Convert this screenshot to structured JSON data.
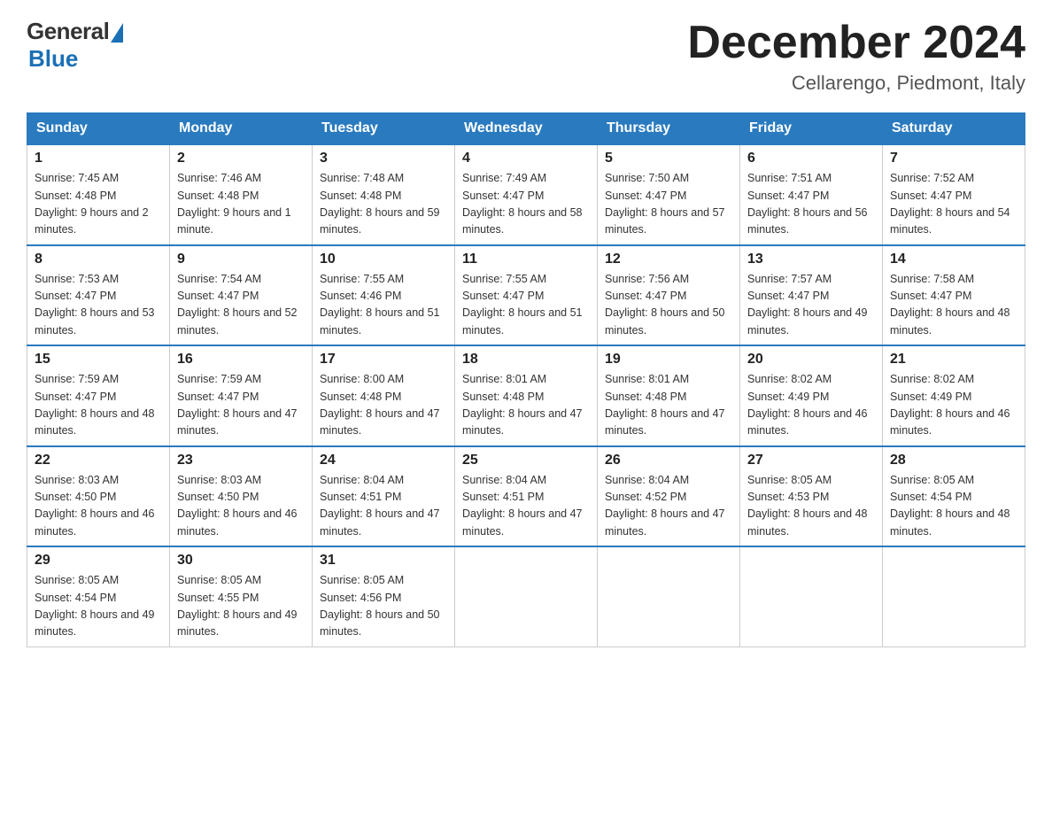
{
  "logo": {
    "general": "General",
    "blue": "Blue",
    "tagline": "Blue"
  },
  "title": "December 2024",
  "location": "Cellarengo, Piedmont, Italy",
  "days_of_week": [
    "Sunday",
    "Monday",
    "Tuesday",
    "Wednesday",
    "Thursday",
    "Friday",
    "Saturday"
  ],
  "weeks": [
    [
      {
        "day": "1",
        "sunrise": "7:45 AM",
        "sunset": "4:48 PM",
        "daylight": "9 hours and 2 minutes."
      },
      {
        "day": "2",
        "sunrise": "7:46 AM",
        "sunset": "4:48 PM",
        "daylight": "9 hours and 1 minute."
      },
      {
        "day": "3",
        "sunrise": "7:48 AM",
        "sunset": "4:48 PM",
        "daylight": "8 hours and 59 minutes."
      },
      {
        "day": "4",
        "sunrise": "7:49 AM",
        "sunset": "4:47 PM",
        "daylight": "8 hours and 58 minutes."
      },
      {
        "day": "5",
        "sunrise": "7:50 AM",
        "sunset": "4:47 PM",
        "daylight": "8 hours and 57 minutes."
      },
      {
        "day": "6",
        "sunrise": "7:51 AM",
        "sunset": "4:47 PM",
        "daylight": "8 hours and 56 minutes."
      },
      {
        "day": "7",
        "sunrise": "7:52 AM",
        "sunset": "4:47 PM",
        "daylight": "8 hours and 54 minutes."
      }
    ],
    [
      {
        "day": "8",
        "sunrise": "7:53 AM",
        "sunset": "4:47 PM",
        "daylight": "8 hours and 53 minutes."
      },
      {
        "day": "9",
        "sunrise": "7:54 AM",
        "sunset": "4:47 PM",
        "daylight": "8 hours and 52 minutes."
      },
      {
        "day": "10",
        "sunrise": "7:55 AM",
        "sunset": "4:46 PM",
        "daylight": "8 hours and 51 minutes."
      },
      {
        "day": "11",
        "sunrise": "7:55 AM",
        "sunset": "4:47 PM",
        "daylight": "8 hours and 51 minutes."
      },
      {
        "day": "12",
        "sunrise": "7:56 AM",
        "sunset": "4:47 PM",
        "daylight": "8 hours and 50 minutes."
      },
      {
        "day": "13",
        "sunrise": "7:57 AM",
        "sunset": "4:47 PM",
        "daylight": "8 hours and 49 minutes."
      },
      {
        "day": "14",
        "sunrise": "7:58 AM",
        "sunset": "4:47 PM",
        "daylight": "8 hours and 48 minutes."
      }
    ],
    [
      {
        "day": "15",
        "sunrise": "7:59 AM",
        "sunset": "4:47 PM",
        "daylight": "8 hours and 48 minutes."
      },
      {
        "day": "16",
        "sunrise": "7:59 AM",
        "sunset": "4:47 PM",
        "daylight": "8 hours and 47 minutes."
      },
      {
        "day": "17",
        "sunrise": "8:00 AM",
        "sunset": "4:48 PM",
        "daylight": "8 hours and 47 minutes."
      },
      {
        "day": "18",
        "sunrise": "8:01 AM",
        "sunset": "4:48 PM",
        "daylight": "8 hours and 47 minutes."
      },
      {
        "day": "19",
        "sunrise": "8:01 AM",
        "sunset": "4:48 PM",
        "daylight": "8 hours and 47 minutes."
      },
      {
        "day": "20",
        "sunrise": "8:02 AM",
        "sunset": "4:49 PM",
        "daylight": "8 hours and 46 minutes."
      },
      {
        "day": "21",
        "sunrise": "8:02 AM",
        "sunset": "4:49 PM",
        "daylight": "8 hours and 46 minutes."
      }
    ],
    [
      {
        "day": "22",
        "sunrise": "8:03 AM",
        "sunset": "4:50 PM",
        "daylight": "8 hours and 46 minutes."
      },
      {
        "day": "23",
        "sunrise": "8:03 AM",
        "sunset": "4:50 PM",
        "daylight": "8 hours and 46 minutes."
      },
      {
        "day": "24",
        "sunrise": "8:04 AM",
        "sunset": "4:51 PM",
        "daylight": "8 hours and 47 minutes."
      },
      {
        "day": "25",
        "sunrise": "8:04 AM",
        "sunset": "4:51 PM",
        "daylight": "8 hours and 47 minutes."
      },
      {
        "day": "26",
        "sunrise": "8:04 AM",
        "sunset": "4:52 PM",
        "daylight": "8 hours and 47 minutes."
      },
      {
        "day": "27",
        "sunrise": "8:05 AM",
        "sunset": "4:53 PM",
        "daylight": "8 hours and 48 minutes."
      },
      {
        "day": "28",
        "sunrise": "8:05 AM",
        "sunset": "4:54 PM",
        "daylight": "8 hours and 48 minutes."
      }
    ],
    [
      {
        "day": "29",
        "sunrise": "8:05 AM",
        "sunset": "4:54 PM",
        "daylight": "8 hours and 49 minutes."
      },
      {
        "day": "30",
        "sunrise": "8:05 AM",
        "sunset": "4:55 PM",
        "daylight": "8 hours and 49 minutes."
      },
      {
        "day": "31",
        "sunrise": "8:05 AM",
        "sunset": "4:56 PM",
        "daylight": "8 hours and 50 minutes."
      },
      null,
      null,
      null,
      null
    ]
  ]
}
